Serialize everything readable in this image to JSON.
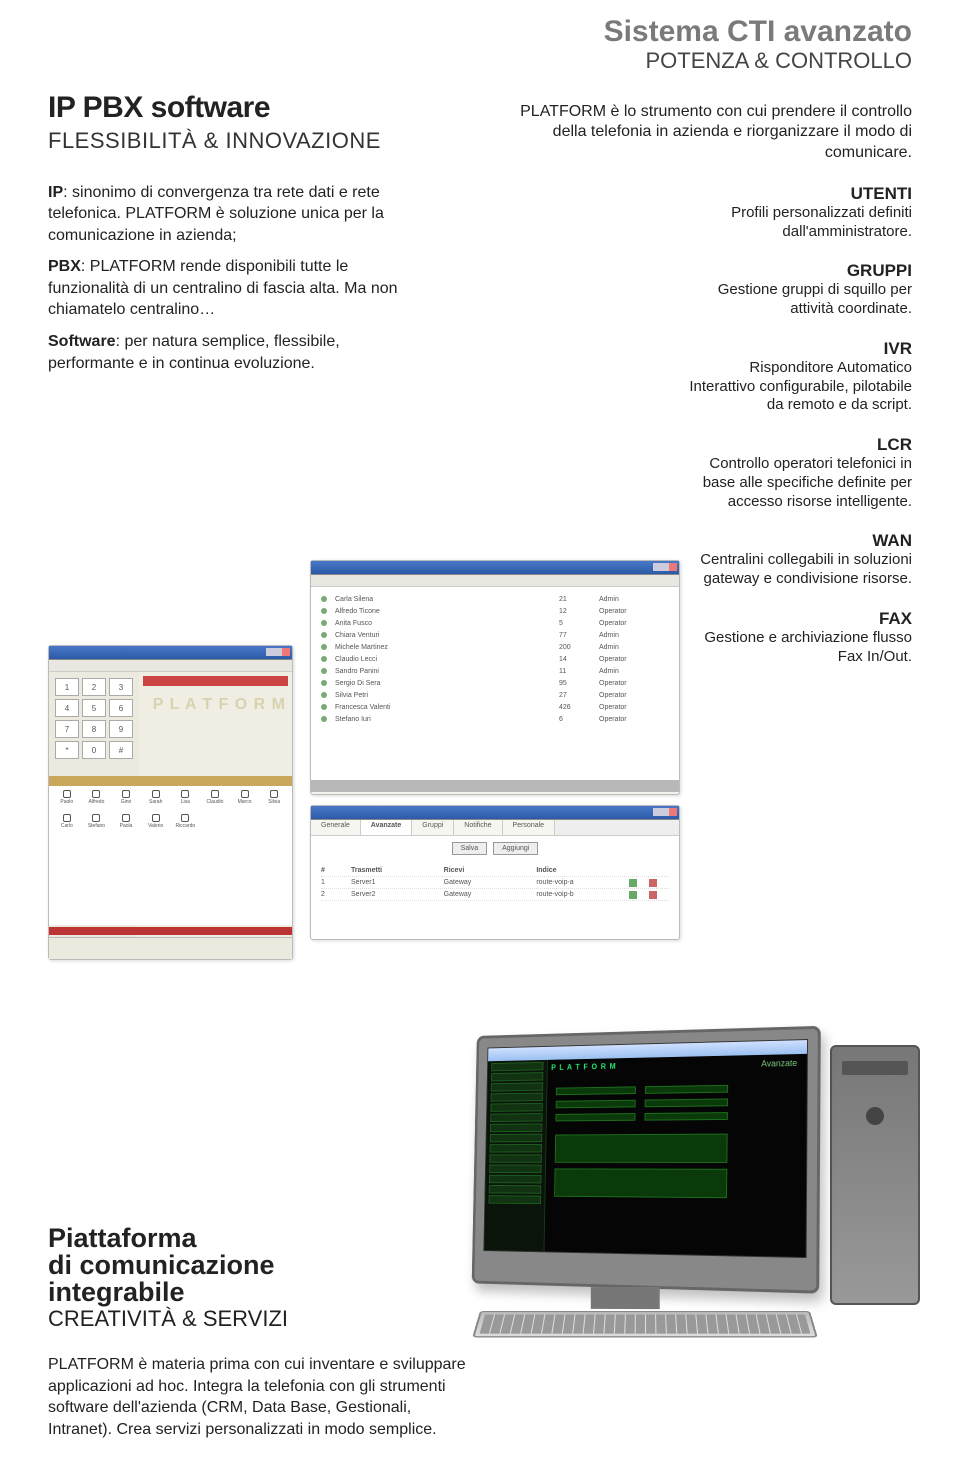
{
  "left": {
    "title": "IP PBX software",
    "subtitle": "FLESSIBILITÀ & INNOVAZIONE",
    "ip_label": "IP",
    "ip_text": ": sinonimo di convergenza tra rete dati e rete telefonica. PLATFORM è soluzione unica per la comunicazione in azienda;",
    "pbx_label": "PBX",
    "pbx_text": ": PLATFORM rende disponibili tutte le funzionalità di un centralino di fascia alta. Ma non chiamatelo centralino…",
    "sw_label": "Software",
    "sw_text": ": per natura semplice, flessibile, performante e in continua evoluzione."
  },
  "right": {
    "title": "Sistema CTI avanzato",
    "subtitle": "POTENZA & CONTROLLO",
    "intro": "PLATFORM è lo strumento con cui prendere il controllo della telefonia in azienda e riorganizzare il modo di comunicare.",
    "features": [
      {
        "label": "UTENTI",
        "desc": "Profili personalizzati definiti dall'amministratore."
      },
      {
        "label": "GRUPPI",
        "desc": "Gestione gruppi di squillo per attività coordinate."
      },
      {
        "label": "IVR",
        "desc": "Risponditore Automatico Interattivo configurabile, pilotabile da remoto e da script."
      },
      {
        "label": "LCR",
        "desc": "Controllo operatori telefonici in base alle specifiche definite per accesso risorse intelligente."
      },
      {
        "label": "WAN",
        "desc": "Centralini collegabili in soluzioni gateway e condivisione risorse."
      },
      {
        "label": "FAX",
        "desc": "Gestione e archiviazione flusso Fax In/Out."
      }
    ]
  },
  "bottom": {
    "title1": "Piattaforma",
    "title2": "di comunicazione",
    "title3": "integrabile",
    "subtitle": "CREATIVITÀ & SERVIZI",
    "body": "PLATFORM è materia prima con cui inventare e sviluppare applicazioni ad hoc. Integra la telefonia con gli strumenti software dell'azienda (CRM, Data Base, Gestionali, Intranet). Crea servizi personalizzati in modo semplice."
  },
  "winA": {
    "watermark": "P L A T F O R M",
    "keys": [
      "1",
      "2",
      "3",
      "4",
      "5",
      "6",
      "7",
      "8",
      "9",
      "*",
      "0",
      "#"
    ],
    "ext_names": [
      "Paolo",
      "Alfredo",
      "Gino",
      "Sarah",
      "Lisa",
      "Claudio",
      "Marco",
      "Silvia",
      "Carlo",
      "Stefano",
      "Paola",
      "Valerio",
      "Riccardo"
    ]
  },
  "winB": {
    "rows": [
      {
        "name": "Carla Silena",
        "num": "21",
        "role": "Admin"
      },
      {
        "name": "Alfredo Ticone",
        "num": "12",
        "role": "Operator"
      },
      {
        "name": "Anita Fusco",
        "num": "5",
        "role": "Operator"
      },
      {
        "name": "Chiara Venturi",
        "num": "77",
        "role": "Admin"
      },
      {
        "name": "Michele Martinez",
        "num": "200",
        "role": "Admin"
      },
      {
        "name": "Claudio Lecci",
        "num": "14",
        "role": "Operator"
      },
      {
        "name": "Sandro Panini",
        "num": "11",
        "role": "Admin"
      },
      {
        "name": "Sergio Di Sera",
        "num": "95",
        "role": "Operator"
      },
      {
        "name": "Silvia Petri",
        "num": "27",
        "role": "Operator"
      },
      {
        "name": "Francesca Valenti",
        "num": "426",
        "role": "Operator"
      },
      {
        "name": "Stefano Iuri",
        "num": "6",
        "role": "Operator"
      }
    ]
  },
  "winC": {
    "tabs": [
      "Generale",
      "Avanzate",
      "Gruppi",
      "Notifiche",
      "Personale"
    ],
    "active_tab": "Avanzate",
    "btn_save": "Salva",
    "btn_add": "Aggiungi",
    "headers": [
      "#",
      "Trasmetti",
      "Ricevi",
      "Indice"
    ],
    "rows": [
      {
        "n": "1",
        "a": "Server1",
        "b": "Gateway",
        "c": "route-voip-a"
      },
      {
        "n": "2",
        "a": "Server2",
        "b": "Gateway",
        "c": "route-voip-b"
      }
    ]
  },
  "screen": {
    "badge": "P L A T F O R M",
    "heading": "Avanzate"
  }
}
